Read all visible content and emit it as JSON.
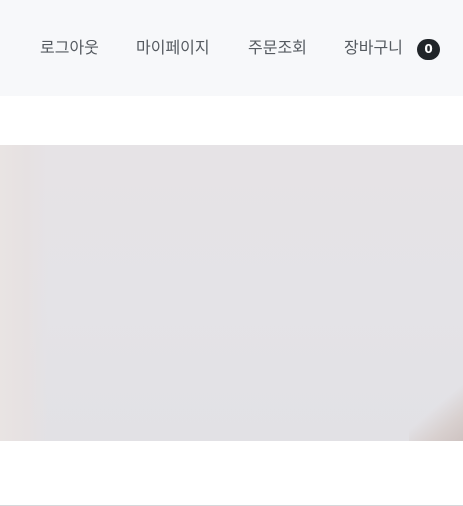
{
  "header": {
    "nav": {
      "logout_label": "로그아웃",
      "mypage_label": "마이페이지",
      "orders_label": "주문조회",
      "cart_label": "장바구니",
      "cart_count": "0"
    }
  },
  "colors": {
    "header_bg": "#f7f8fa",
    "nav_text": "#555a60",
    "badge_bg": "#212529",
    "badge_text": "#ffffff",
    "hero_bg": "#e4e3e7"
  }
}
